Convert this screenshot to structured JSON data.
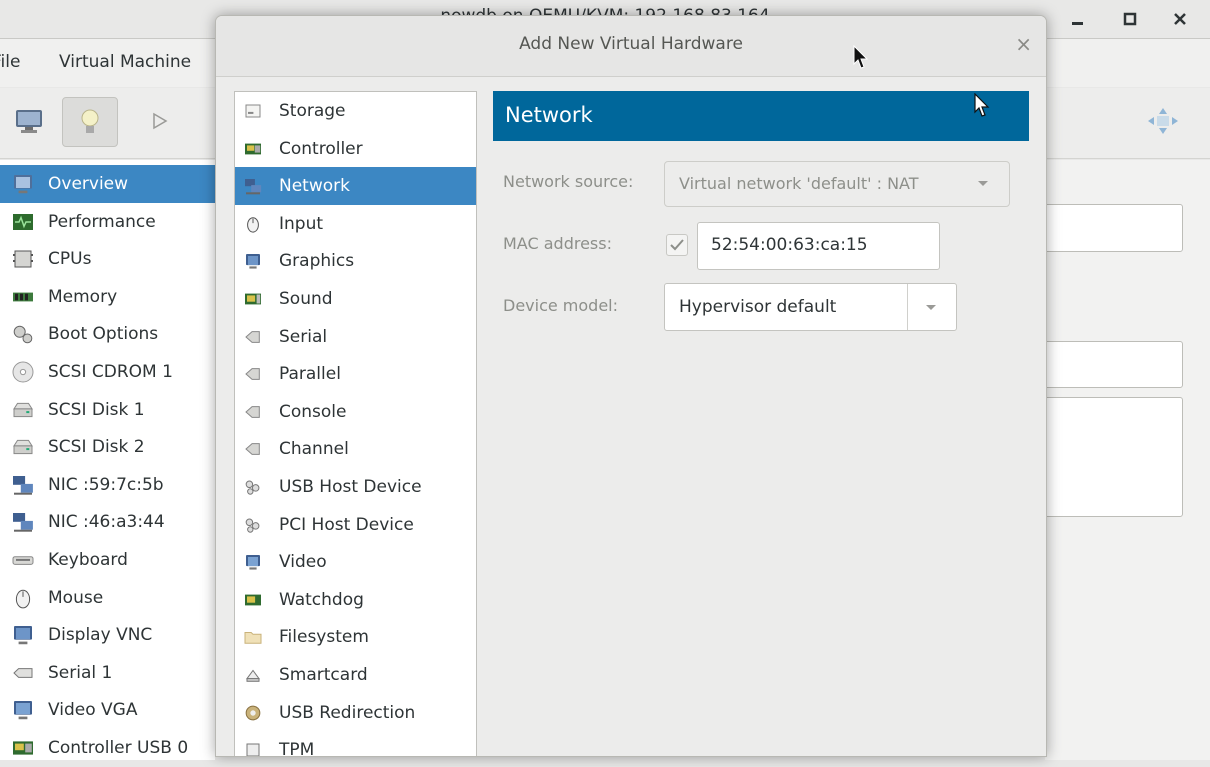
{
  "main_window": {
    "title": "nowdb on QEMU/KVM: 192.168.83.164",
    "menu": [
      "File",
      "Virtual Machine"
    ],
    "sidebar": [
      {
        "label": "Overview",
        "icon": "monitor-icon",
        "selected": true
      },
      {
        "label": "Performance",
        "icon": "performance-graph-icon"
      },
      {
        "label": "CPUs",
        "icon": "cpu-chip-icon"
      },
      {
        "label": "Memory",
        "icon": "memory-module-icon"
      },
      {
        "label": "Boot Options",
        "icon": "gears-icon"
      },
      {
        "label": "SCSI CDROM 1",
        "icon": "cdrom-icon"
      },
      {
        "label": "SCSI Disk 1",
        "icon": "disk-drive-icon"
      },
      {
        "label": "SCSI Disk 2",
        "icon": "disk-drive-icon"
      },
      {
        "label": "NIC :59:7c:5b",
        "icon": "network-icon"
      },
      {
        "label": "NIC :46:a3:44",
        "icon": "network-icon"
      },
      {
        "label": "Keyboard",
        "icon": "keyboard-icon"
      },
      {
        "label": "Mouse",
        "icon": "mouse-icon"
      },
      {
        "label": "Display VNC",
        "icon": "display-icon"
      },
      {
        "label": "Serial 1",
        "icon": "serial-icon"
      },
      {
        "label": "Video VGA",
        "icon": "video-icon"
      },
      {
        "label": "Controller USB 0",
        "icon": "controller-icon"
      }
    ]
  },
  "dialog": {
    "title": "Add New Virtual Hardware",
    "close_label": "×",
    "hardware_list": [
      {
        "label": "Storage",
        "icon": "storage-icon"
      },
      {
        "label": "Controller",
        "icon": "controller-icon"
      },
      {
        "label": "Network",
        "icon": "network-icon",
        "selected": true
      },
      {
        "label": "Input",
        "icon": "mouse-icon"
      },
      {
        "label": "Graphics",
        "icon": "display-icon"
      },
      {
        "label": "Sound",
        "icon": "sound-card-icon"
      },
      {
        "label": "Serial",
        "icon": "serial-port-icon"
      },
      {
        "label": "Parallel",
        "icon": "parallel-port-icon"
      },
      {
        "label": "Console",
        "icon": "console-port-icon"
      },
      {
        "label": "Channel",
        "icon": "channel-port-icon"
      },
      {
        "label": "USB Host Device",
        "icon": "usb-device-icon"
      },
      {
        "label": "PCI Host Device",
        "icon": "pci-device-icon"
      },
      {
        "label": "Video",
        "icon": "video-icon"
      },
      {
        "label": "Watchdog",
        "icon": "watchdog-icon"
      },
      {
        "label": "Filesystem",
        "icon": "folder-icon"
      },
      {
        "label": "Smartcard",
        "icon": "smartcard-icon"
      },
      {
        "label": "USB Redirection",
        "icon": "usb-redirection-icon"
      },
      {
        "label": "TPM",
        "icon": "tpm-chip-icon"
      }
    ],
    "network": {
      "header": "Network",
      "source_label": "Network source:",
      "source_value": "Virtual network 'default' : NAT",
      "mac_label": "MAC address:",
      "mac_checked": true,
      "mac_value": "52:54:00:63:ca:15",
      "model_label": "Device model:",
      "model_value": "Hypervisor default"
    }
  },
  "colors": {
    "selection": "#3c87c3",
    "header": "#00679b"
  }
}
